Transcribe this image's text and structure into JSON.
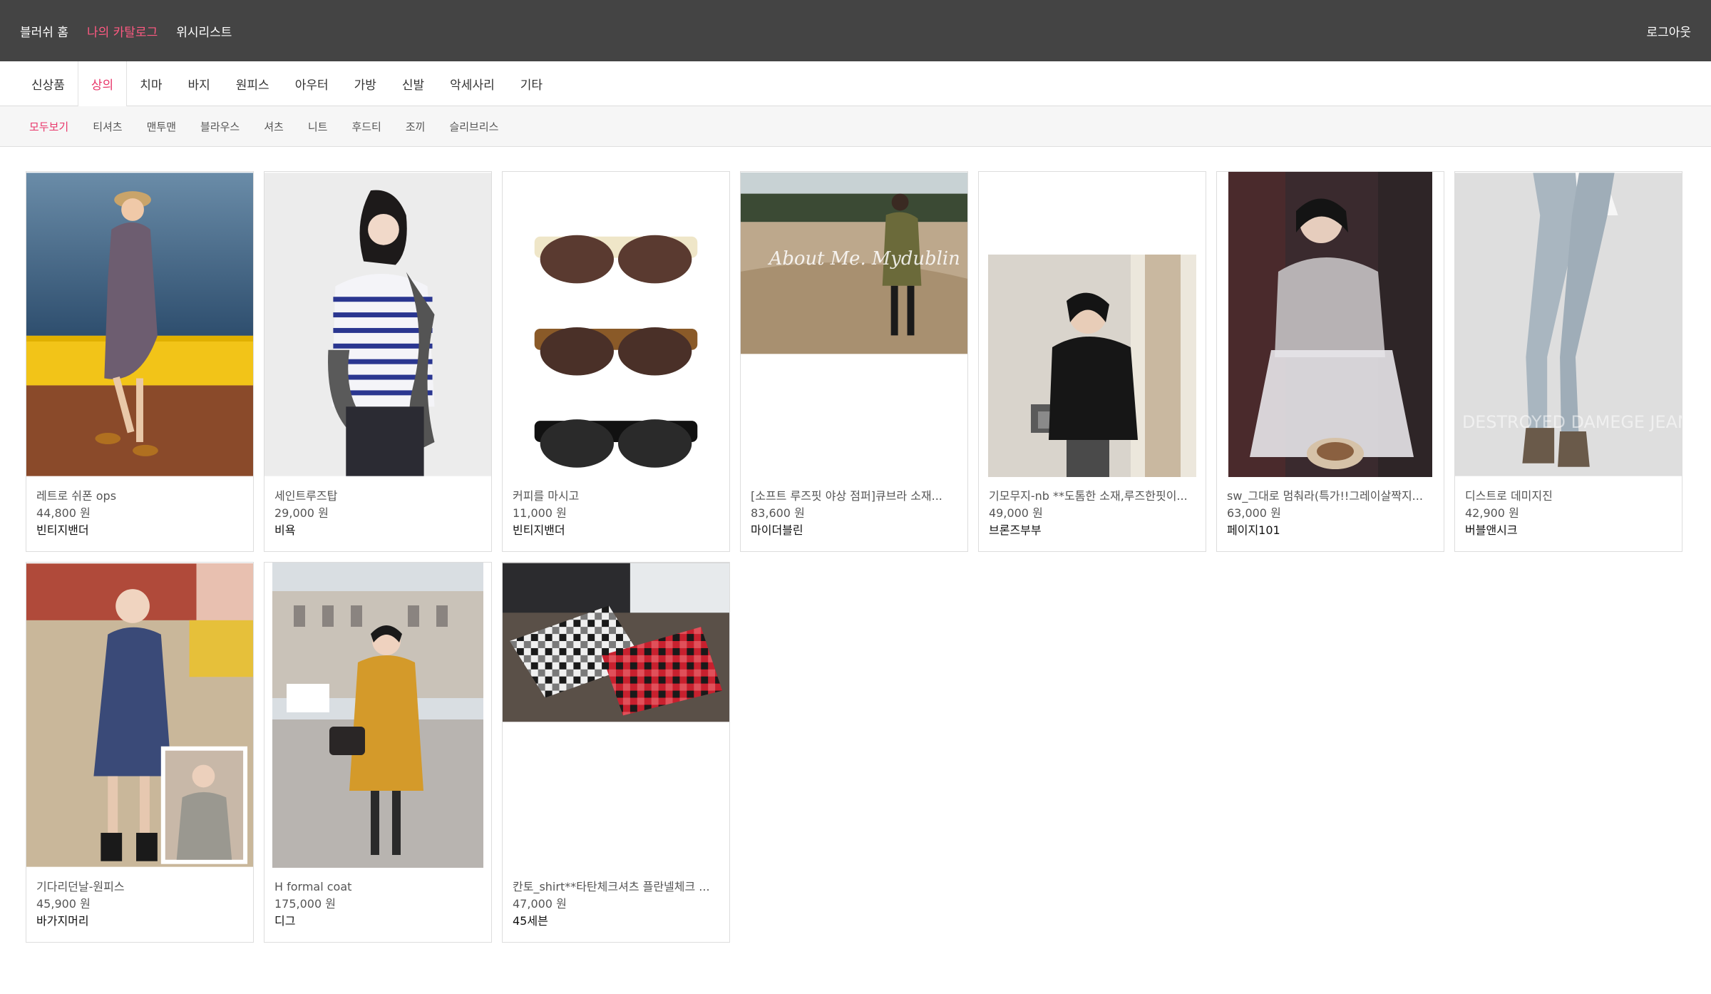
{
  "topnav": {
    "home": "블러쉬 홈",
    "catalog": "나의 카탈로그",
    "wishlist": "위시리스트",
    "logout": "로그아웃"
  },
  "categories": [
    "신상품",
    "상의",
    "치마",
    "바지",
    "원피스",
    "아우터",
    "가방",
    "신발",
    "악세사리",
    "기타"
  ],
  "active_category": "상의",
  "subcategories": [
    "모두보기",
    "티셔츠",
    "맨투맨",
    "블라우스",
    "셔츠",
    "니트",
    "후드티",
    "조끼",
    "슬리브리스"
  ],
  "active_subcategory": "모두보기",
  "products": [
    {
      "name": "레트로 쉬폰 ops",
      "price": "44,800 원",
      "shop": "빈티지밴더"
    },
    {
      "name": "세인트루즈탑",
      "price": "29,000 원",
      "shop": "비욕"
    },
    {
      "name": "커피를 마시고",
      "price": "11,000 원",
      "shop": "빈티지밴더"
    },
    {
      "name": "[소프트 루즈핏 야상 점퍼]큐브라 소재...",
      "price": "83,600 원",
      "shop": "마이더블린"
    },
    {
      "name": "기모무지-nb **도톰한 소재,루즈한핏이...",
      "price": "49,000 원",
      "shop": "브론즈부부"
    },
    {
      "name": "sw_그대로 멈춰라(특가!!그레이살짝지...",
      "price": "63,000 원",
      "shop": "페이지101"
    },
    {
      "name": "디스트로 데미지진",
      "price": "42,900 원",
      "shop": "버블앤시크"
    },
    {
      "name": "기다리던날-원피스",
      "price": "45,900 원",
      "shop": "바가지머리"
    },
    {
      "name": "H formal coat",
      "price": "175,000 원",
      "shop": "디그"
    },
    {
      "name": "칸토_shirt**타탄체크셔츠 플란넬체크 ...",
      "price": "47,000 원",
      "shop": "45세븐"
    }
  ],
  "colors": {
    "topbar": "#444444",
    "accent": "#e8366a"
  },
  "image_text": {
    "jacket_script": "About Me. Mydublin",
    "jeans_overlay": "DESTROYED DAMEGE JEANS"
  }
}
